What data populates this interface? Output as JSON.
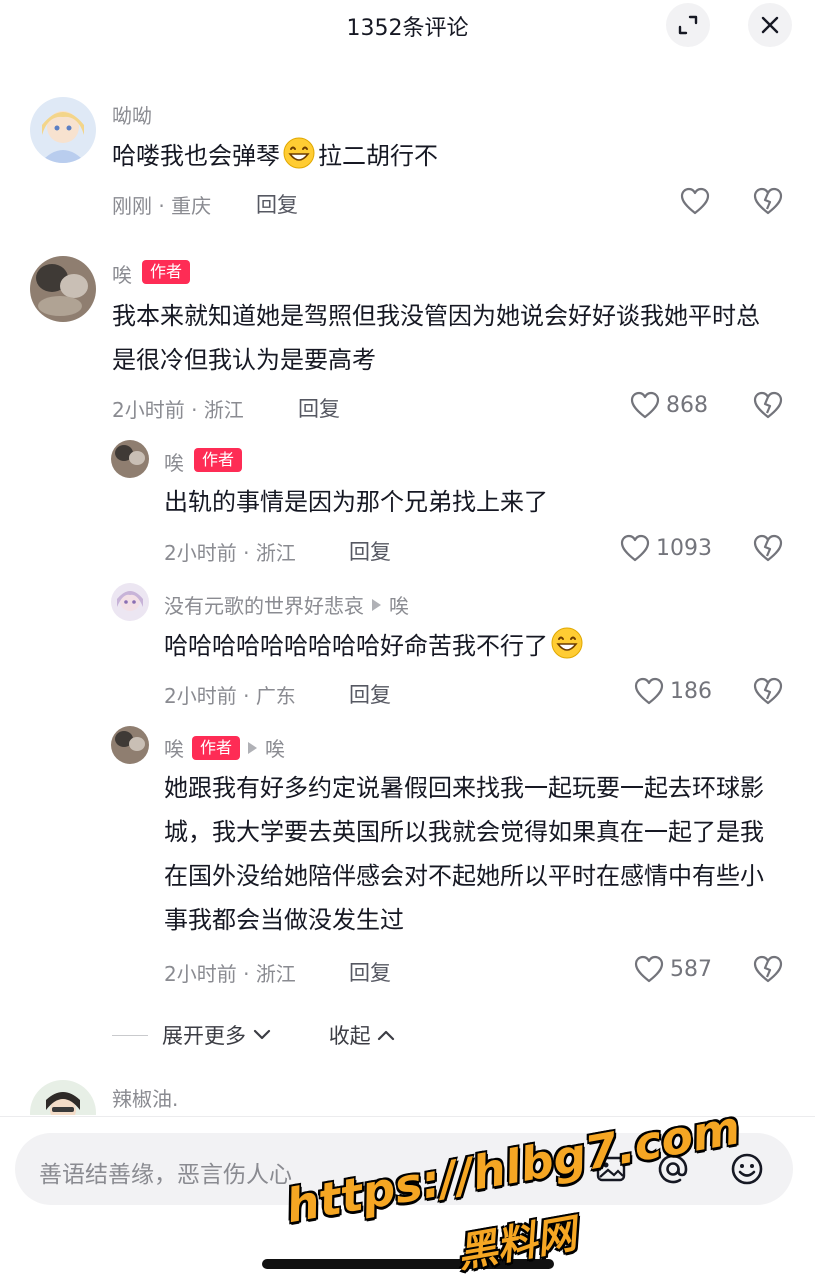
{
  "header": {
    "title": "1352条评论",
    "expand_icon": "expand-icon",
    "close_icon": "close-icon"
  },
  "comments": [
    {
      "username": "呦呦",
      "text": "哈喽我也会弹琴😁拉二胡行不",
      "time": "刚刚",
      "location": "重庆",
      "reply_label": "回复",
      "likes": ""
    },
    {
      "username": "唉",
      "badge": "作者",
      "text": "我本来就知道她是驾照但我没管因为她说会好好谈我她平时总是很冷但我认为是要高考",
      "time": "2小时前",
      "location": "浙江",
      "reply_label": "回复",
      "likes": "868"
    }
  ],
  "replies": [
    {
      "username": "唉",
      "badge": "作者",
      "reply_to": "",
      "text": "出轨的事情是因为那个兄弟找上来了",
      "time": "2小时前",
      "location": "浙江",
      "reply_label": "回复",
      "likes": "1093"
    },
    {
      "username": "没有元歌的世界好悲哀",
      "badge": "",
      "reply_to": "唉",
      "text": "哈哈哈哈哈哈哈哈哈好命苦我不行了😁",
      "time": "2小时前",
      "location": "广东",
      "reply_label": "回复",
      "likes": "186"
    },
    {
      "username": "唉",
      "badge": "作者",
      "reply_to": "唉",
      "text": "她跟我有好多约定说暑假回来找我一起玩要一起去环球影城，我大学要去英国所以我就会觉得如果真在一起了是我在国外没给她陪伴感会对不起她所以平时在感情中有些小事我都会当做没发生过",
      "time": "2小时前",
      "location": "浙江",
      "reply_label": "回复",
      "likes": "587"
    }
  ],
  "thread_controls": {
    "expand_more": "展开更多",
    "collapse": "收起"
  },
  "next_comment": {
    "username": "辣椒油."
  },
  "input": {
    "placeholder": "善语结善缘，恶言伤人心"
  },
  "watermark": {
    "url": "https://hlbg7.com",
    "name": "黑料网"
  },
  "colors": {
    "author_badge": "#fe2c55",
    "watermark": "#f5a623"
  }
}
